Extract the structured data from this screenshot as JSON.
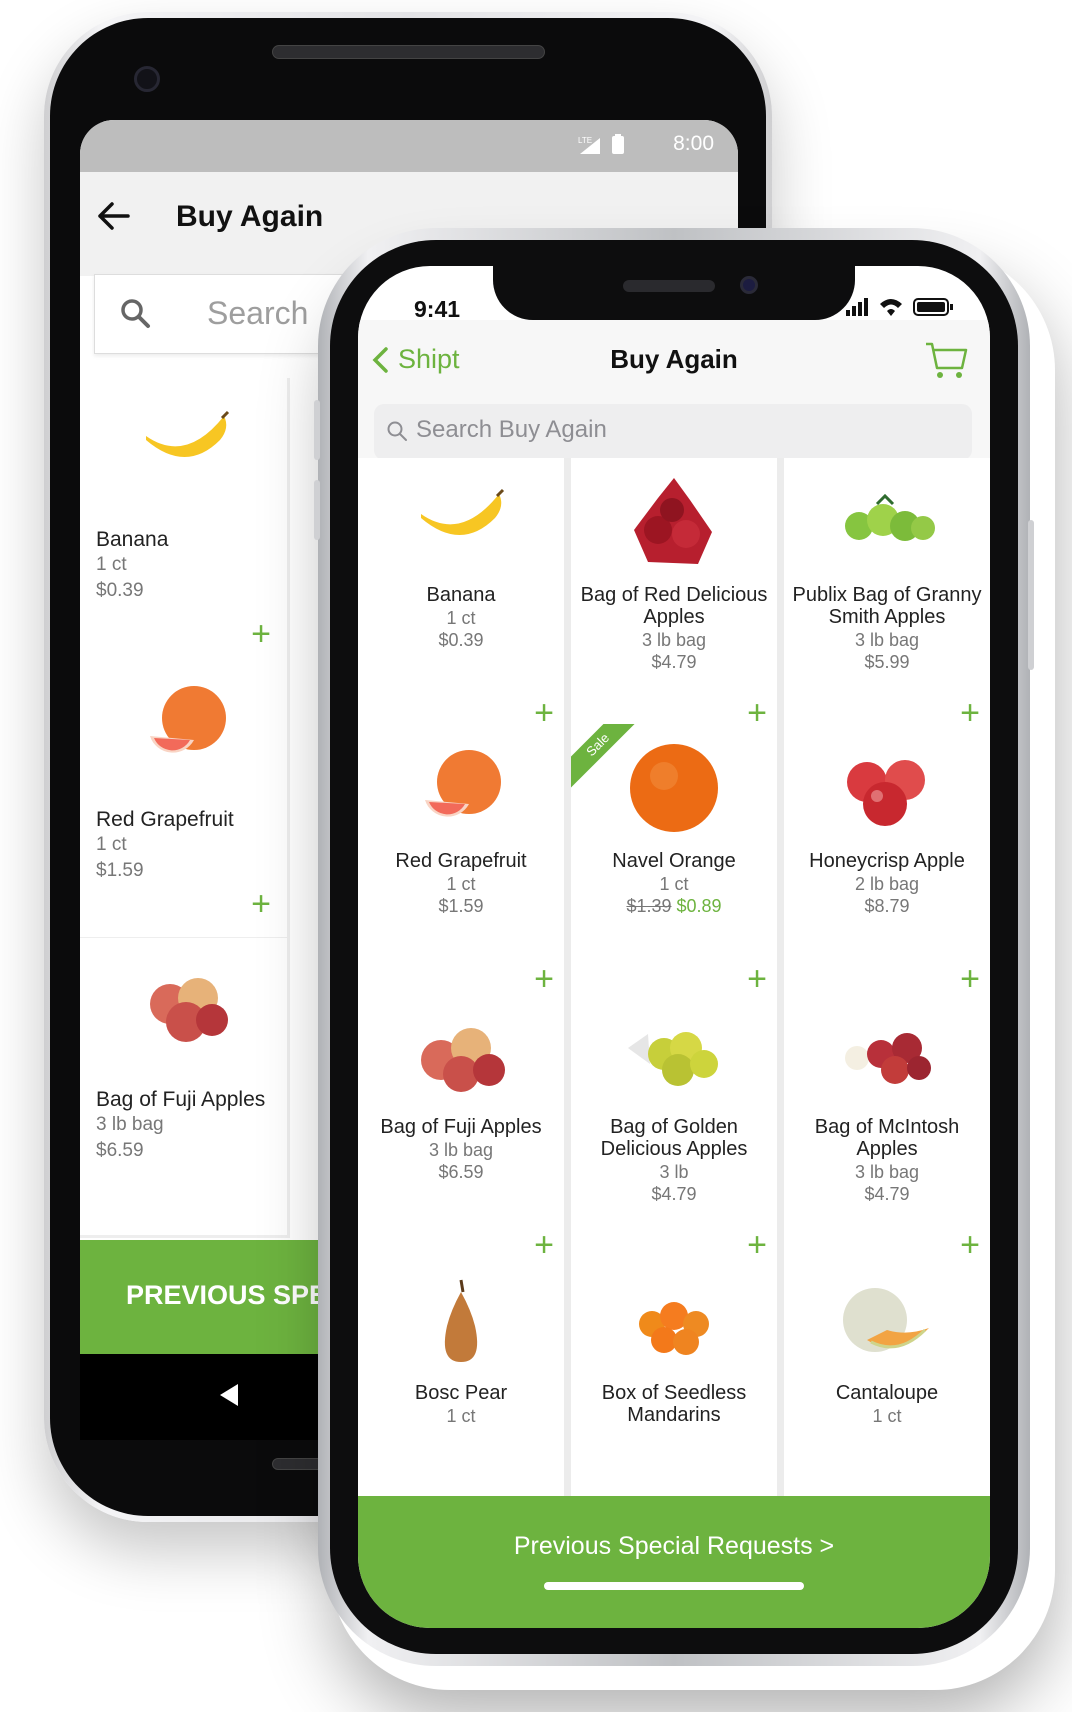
{
  "android": {
    "status": {
      "time": "8:00",
      "network": "LTE"
    },
    "title": "Buy Again",
    "search_placeholder": "Search",
    "products": [
      {
        "name": "Banana",
        "unit": "1 ct",
        "price": "$0.39",
        "icon": "banana"
      },
      {
        "name": "Red Grapefruit",
        "unit": "1 ct",
        "price": "$1.59",
        "icon": "grapefruit"
      },
      {
        "name": "Bag of Fuji Apples",
        "unit": "3 lb bag",
        "price": "$6.59",
        "icon": "fuji-apples"
      }
    ],
    "bottom_button": "PREVIOUS SPE"
  },
  "iphone": {
    "status": {
      "time": "9:41"
    },
    "nav": {
      "back_label": "Shipt",
      "title": "Buy Again"
    },
    "search_placeholder": "Search Buy Again",
    "products": [
      {
        "name": "Banana",
        "unit": "1 ct",
        "price": "$0.39",
        "icon": "banana"
      },
      {
        "name": "Bag of Red Delicious Apples",
        "unit": "3 lb bag",
        "price": "$4.79",
        "icon": "red-apples-bag"
      },
      {
        "name": "Publix Bag of Granny Smith Apples",
        "unit": "3 lb bag",
        "price": "$5.99",
        "icon": "green-apples"
      },
      {
        "name": "Red Grapefruit",
        "unit": "1 ct",
        "price": "$1.59",
        "icon": "grapefruit"
      },
      {
        "name": "Navel Orange",
        "unit": "1 ct",
        "old_price": "$1.39",
        "sale_price": "$0.89",
        "badge": "Sale",
        "icon": "orange"
      },
      {
        "name": "Honeycrisp Apple",
        "unit": "2 lb bag",
        "price": "$8.79",
        "icon": "honeycrisp"
      },
      {
        "name": "Bag of Fuji Apples",
        "unit": "3 lb bag",
        "price": "$6.59",
        "icon": "fuji-apples"
      },
      {
        "name": "Bag of Golden Delicious Apples",
        "unit": "3 lb",
        "price": "$4.79",
        "icon": "golden-apples"
      },
      {
        "name": "Bag of McIntosh Apples",
        "unit": "3 lb bag",
        "price": "$4.79",
        "icon": "mcintosh"
      },
      {
        "name": "Bosc Pear",
        "unit": "1 ct",
        "price": "",
        "icon": "pear"
      },
      {
        "name": "Box of Seedless Mandarins",
        "unit": "",
        "price": "",
        "icon": "mandarins"
      },
      {
        "name": "Cantaloupe",
        "unit": "1 ct",
        "price": "",
        "icon": "cantaloupe"
      }
    ],
    "footer_button": "Previous Special Requests >"
  },
  "colors": {
    "accent": "#6db33f"
  }
}
